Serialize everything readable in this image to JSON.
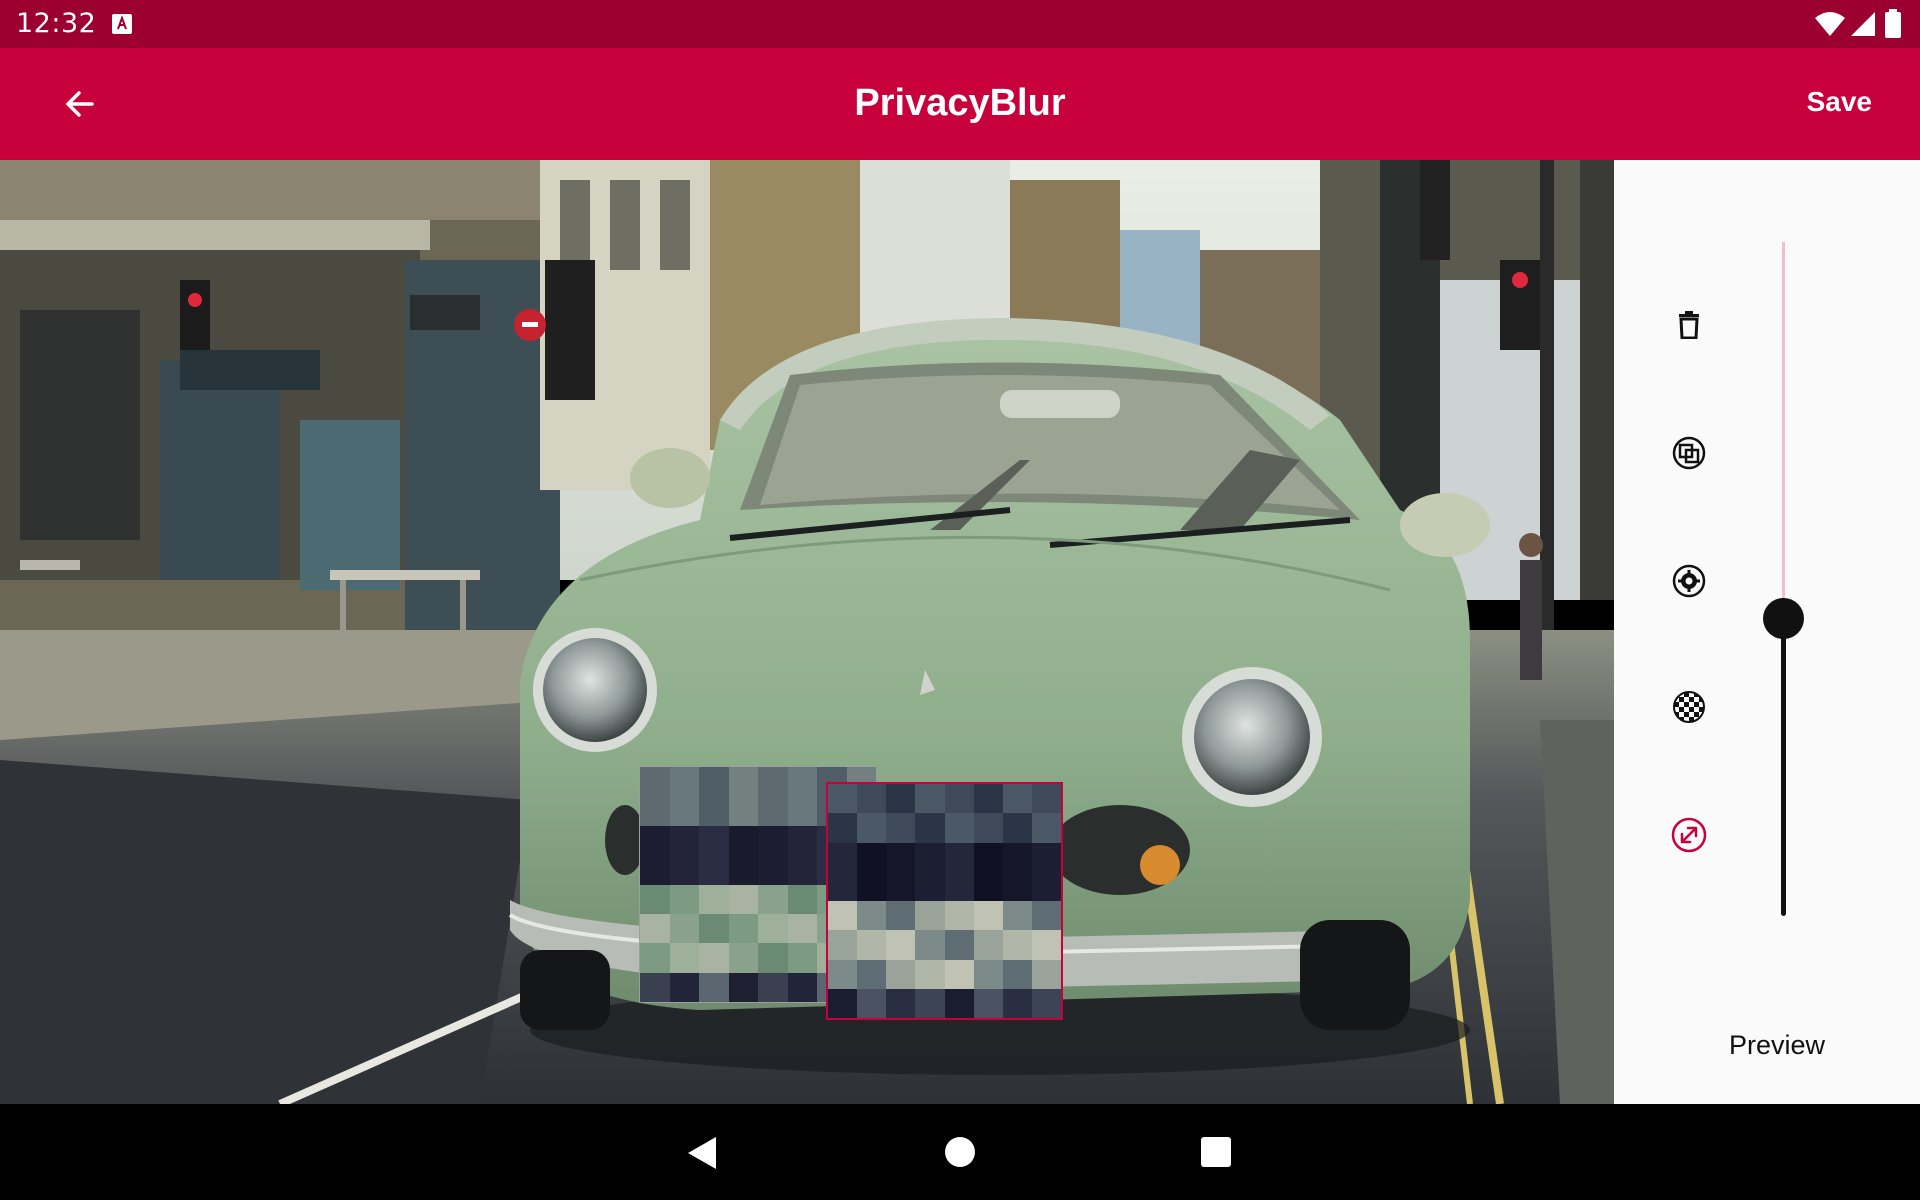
{
  "status_bar": {
    "time": "12:32",
    "icons": [
      "a-notification-icon",
      "wifi-icon",
      "signal-icon",
      "battery-icon"
    ]
  },
  "app_bar": {
    "title": "PrivacyBlur",
    "back_icon": "arrow-back-icon",
    "save_label": "Save",
    "color": "#c8003c"
  },
  "photo": {
    "description_icon": "photo-canvas",
    "blur_regions": 2,
    "selected_region_color": "#c8003c"
  },
  "toolbar": {
    "tools": [
      {
        "name": "delete-tool",
        "icon": "trash-icon"
      },
      {
        "name": "shape-tool",
        "icon": "shapes-icon"
      },
      {
        "name": "settings-tool",
        "icon": "gear-icon"
      },
      {
        "name": "pixelate-tool",
        "icon": "checkerboard-icon"
      },
      {
        "name": "resize-tool",
        "icon": "resize-diagonal-icon",
        "active": true
      }
    ],
    "active_color": "#c8003c"
  },
  "slider": {
    "value": 0.45,
    "fill_color": "#111111",
    "track_color": "#f2bfd0"
  },
  "preview_label": "Preview",
  "nav_bar": {
    "icons": [
      "nav-back-icon",
      "nav-home-icon",
      "nav-recents-icon"
    ]
  }
}
